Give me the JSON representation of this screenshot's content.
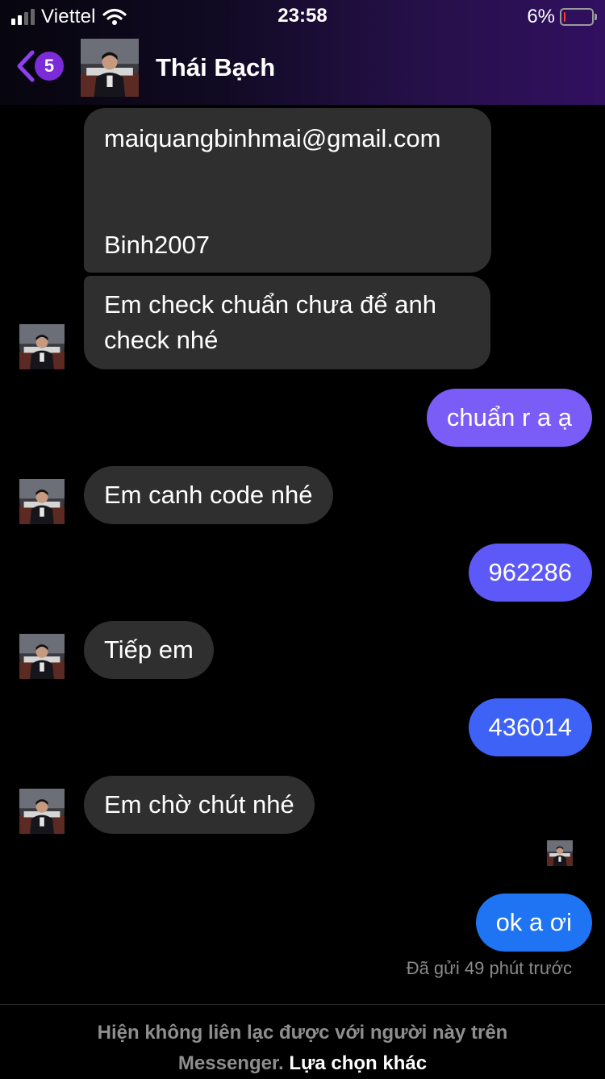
{
  "status_bar": {
    "carrier": "Viettel",
    "time": "23:58",
    "battery_percent": "6%",
    "battery_level": 0.06,
    "signal_bars_active": 2,
    "signal_bars_total": 4
  },
  "header": {
    "unread_count": "5",
    "contact_name": "Thái Bạch"
  },
  "colors": {
    "incoming_bubble": "#2f2f2f",
    "accent_purple": "#7c2bd9",
    "battery_low": "#ff3b30"
  },
  "messages": [
    {
      "direction": "in",
      "lines": [
        "maiquangbinhmai@gmail.com",
        "",
        "",
        "Binh2007"
      ]
    },
    {
      "direction": "in",
      "lines": [
        "Em check chuẩn chưa để anh",
        "check nhé"
      ]
    },
    {
      "direction": "out",
      "lines": [
        "chuẩn r a ạ"
      ]
    },
    {
      "direction": "in",
      "lines": [
        "Em canh code nhé"
      ]
    },
    {
      "direction": "out",
      "lines": [
        "962286"
      ]
    },
    {
      "direction": "in",
      "lines": [
        "Tiếp em"
      ]
    },
    {
      "direction": "out",
      "lines": [
        "436014"
      ]
    },
    {
      "direction": "in",
      "lines": [
        "Em chờ chút nhé"
      ]
    },
    {
      "direction": "out",
      "lines": [
        "ok a ơi"
      ]
    }
  ],
  "sent_status": "Đã gửi 49 phút trước",
  "footer": {
    "notice_line1": "Hiện không liên lạc được với người này trên",
    "notice_line2": "Messenger.",
    "link_text": "Lựa chọn khác"
  }
}
